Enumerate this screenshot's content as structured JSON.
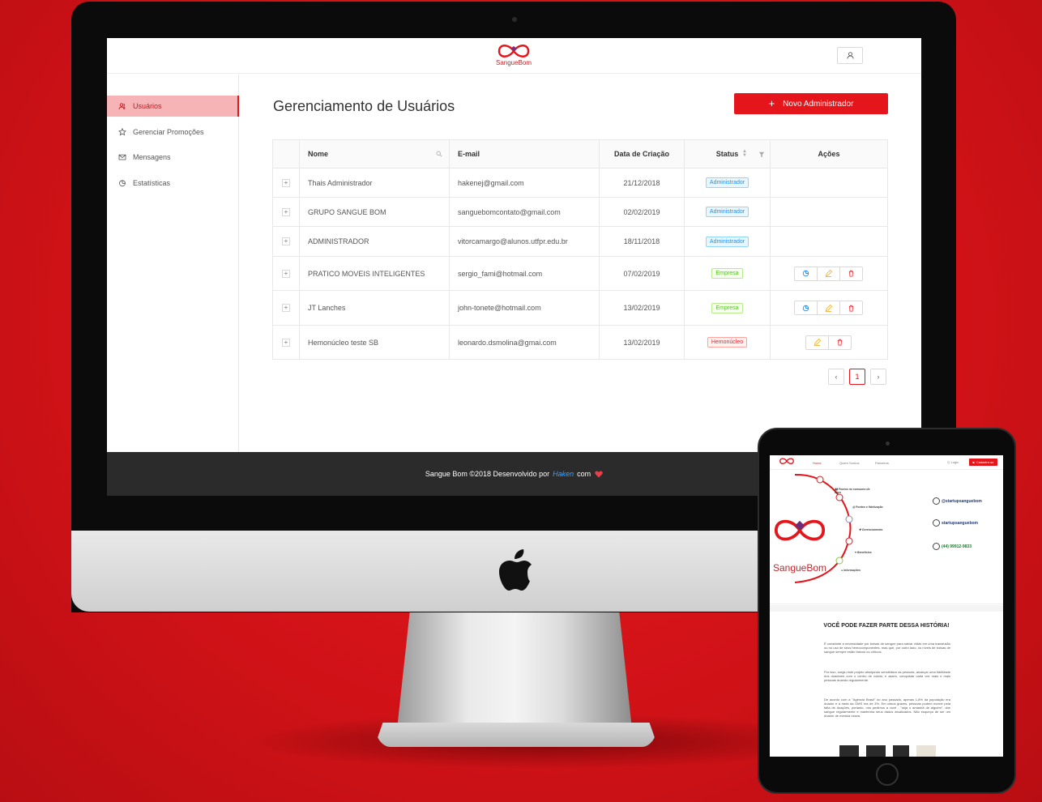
{
  "app": {
    "logo_text": "SangueBom",
    "accent_color": "#e4151b"
  },
  "sidebar": {
    "items": [
      {
        "label": "Usuários",
        "icon": "users-icon",
        "active": true
      },
      {
        "label": "Gerenciar Promoções",
        "icon": "star-icon",
        "active": false
      },
      {
        "label": "Mensagens",
        "icon": "mail-icon",
        "active": false
      },
      {
        "label": "Estatísticas",
        "icon": "pie-chart-icon",
        "active": false
      }
    ]
  },
  "main": {
    "title": "Gerenciamento de Usuários",
    "new_admin_label": "Novo Administrador",
    "table": {
      "columns": [
        "Nome",
        "E-mail",
        "Data de Criação",
        "Status",
        "Ações"
      ],
      "rows": [
        {
          "name": "Thais Administrador",
          "email": "hakenej@gmail.com",
          "date": "21/12/2018",
          "status": "Administrador",
          "status_type": "admin",
          "actions": []
        },
        {
          "name": "GRUPO SANGUE BOM",
          "email": "sanguebomcontato@gmail.com",
          "date": "02/02/2019",
          "status": "Administrador",
          "status_type": "admin",
          "actions": []
        },
        {
          "name": "ADMINISTRADOR",
          "email": "vitorcamargo@alunos.utfpr.edu.br",
          "date": "18/11/2018",
          "status": "Administrador",
          "status_type": "admin",
          "actions": []
        },
        {
          "name": "PRATICO MOVEIS INTELIGENTES",
          "email": "sergio_fami@hotmail.com",
          "date": "07/02/2019",
          "status": "Empresa",
          "status_type": "empresa",
          "actions": [
            "stats",
            "edit",
            "delete"
          ]
        },
        {
          "name": "JT Lanches",
          "email": "john-tonete@hotmail.com",
          "date": "13/02/2019",
          "status": "Empresa",
          "status_type": "empresa",
          "actions": [
            "stats",
            "edit",
            "delete"
          ]
        },
        {
          "name": "Hemonúcleo teste SB",
          "email": "leonardo.dsmolina@gmai.com",
          "date": "13/02/2019",
          "status": "Hemonúcleo",
          "status_type": "hemo",
          "actions": [
            "edit",
            "delete"
          ]
        }
      ]
    },
    "pagination": {
      "current_page": "1"
    }
  },
  "footer": {
    "text_before": "Sangue Bom ©2018 Desenvolvido por",
    "author": "Haken",
    "text_after": "com"
  },
  "tablet": {
    "nav": {
      "home": "Home",
      "about": "Quem Somos",
      "partners": "Parceiros",
      "login": "Login",
      "signup": "Cadastre-se"
    },
    "hero_logo": "SangueBom",
    "social": [
      "@startupsanguebom",
      "startupsanguebom",
      "(44) 99912-9833"
    ],
    "heading": "VOCÊ PODE FAZER PARTE DESSA HISTÓRIA!",
    "paragraphs": [
      "É constante a necessidade por bolsas de sangue para salvar vidas em uma transfusão ou no uso de seus hemocomponentes, mas que, por outro lado, os níveis de bolsas de sangue sempre estão baixos ou críticos.",
      "Por isso, surgiu este projeto almejando sensibilizar as pessoas, alcançar uma fidelidade dos doadores com o centro de coleta, e assim, conquistar cada vez mais e mais pessoas doando regularmente.",
      "De acordo com a \"Agência Brasil\" do ano passado, apenas 1,8% da população era doador e a meta da OMS era de 3%. Em casos graves, pessoas podem morrer pela falta de doações, portanto, nós pedimos a você - \"seja o amanhã de alguém\", doe sangue regularmente e mantenha seus dados atualizados. Não esqueça de ser um doador de medula óssea."
    ]
  }
}
